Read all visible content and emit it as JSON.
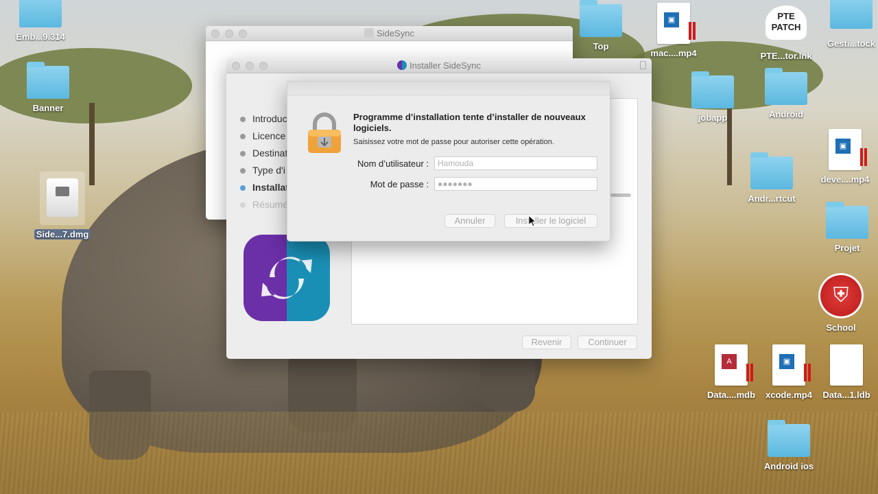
{
  "desktop": {
    "icons_left": [
      {
        "label": "Emb...9.314",
        "type": "folder"
      },
      {
        "label": "Banner",
        "type": "folder"
      },
      {
        "label": "Side...7.dmg",
        "type": "dmg"
      }
    ],
    "icons_right": [
      {
        "label": "Top",
        "type": "folder"
      },
      {
        "label": "mac....mp4",
        "type": "video"
      },
      {
        "label": "PTE...tor.lnk",
        "type": "shortcut"
      },
      {
        "label": "Gesti...tock",
        "type": "folder"
      },
      {
        "label": "jobapp",
        "type": "folder"
      },
      {
        "label": "Android",
        "type": "folder"
      },
      {
        "label": "Andr...rtcut",
        "type": "folder"
      },
      {
        "label": "deve....mp4",
        "type": "video"
      },
      {
        "label": "Projet",
        "type": "folder"
      },
      {
        "label": "School",
        "type": "app"
      },
      {
        "label": "Data....mdb",
        "type": "access"
      },
      {
        "label": "xcode.mp4",
        "type": "video"
      },
      {
        "label": "Data...1.ldb",
        "type": "doc"
      },
      {
        "label": "Android ios",
        "type": "folder"
      }
    ],
    "pte_logo_text": "PTE PATCH"
  },
  "sidesync_window": {
    "title": "SideSync"
  },
  "installer_window": {
    "title": "Installer SideSync",
    "steps": [
      {
        "label": "Introduc",
        "state": "done"
      },
      {
        "label": "Licence",
        "state": "done"
      },
      {
        "label": "Destinat",
        "state": "done"
      },
      {
        "label": "Type d'i",
        "state": "done"
      },
      {
        "label": "Installat",
        "state": "active"
      },
      {
        "label": "Résumé",
        "state": "pending"
      }
    ],
    "back_button": "Revenir",
    "continue_button": "Continuer"
  },
  "auth_dialog": {
    "title": "Programme d’installation tente d’installer de nouveaux logiciels.",
    "subtitle": "Saisissez votre mot de passe pour autoriser cette opération.",
    "username_label": "Nom d’utilisateur :",
    "username_value": "Hamouda",
    "password_label": "Mot de passe :",
    "password_value": "●●●●●●●",
    "cancel_button": "Annuler",
    "install_button": "Installer le logiciel"
  },
  "colors": {
    "accent_step": "#5a9fd6",
    "folder_blue": "#5bb8e0",
    "logo_purple": "#6b2fa8",
    "logo_teal": "#1a8fb5"
  }
}
